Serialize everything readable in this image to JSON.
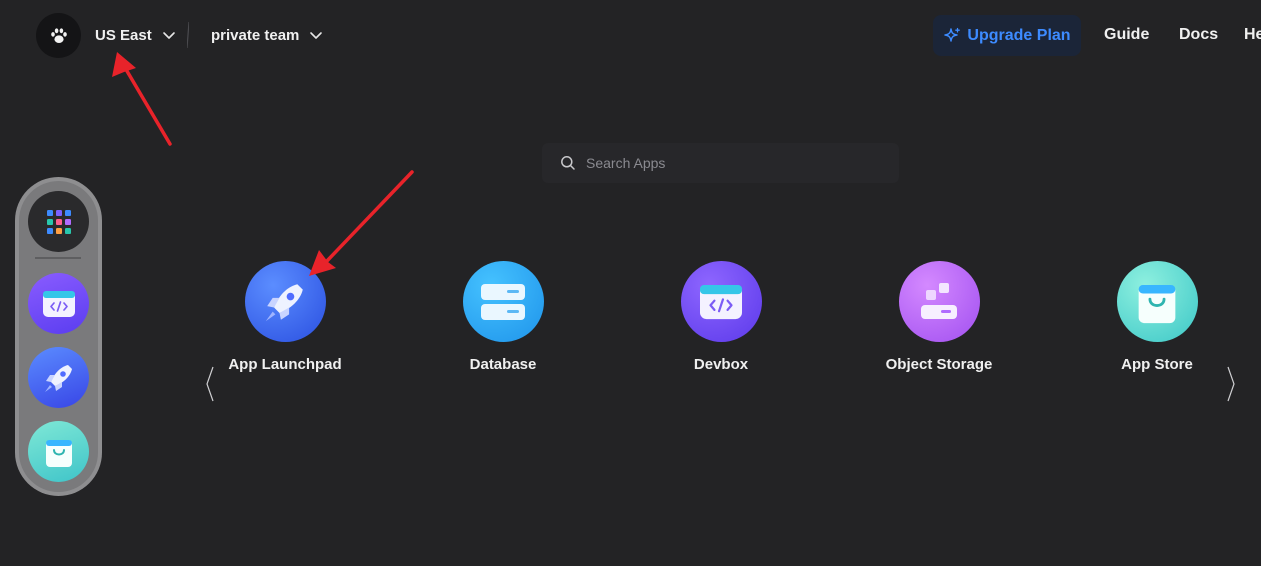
{
  "header": {
    "avatar_icon": "paw-icon",
    "region": "US East",
    "team": "private team",
    "upgrade_label": "Upgrade Plan",
    "links": [
      "Guide",
      "Docs",
      "He"
    ]
  },
  "search": {
    "placeholder": "Search Apps"
  },
  "dock": {
    "items": [
      "apps-grid-icon",
      "devbox-icon",
      "app-launchpad-icon",
      "app-store-icon"
    ]
  },
  "apps": [
    {
      "label": "App Launchpad",
      "icon": "rocket-icon"
    },
    {
      "label": "Database",
      "icon": "database-icon"
    },
    {
      "label": "Devbox",
      "icon": "devbox-icon"
    },
    {
      "label": "Object Storage",
      "icon": "object-storage-icon"
    },
    {
      "label": "App Store",
      "icon": "shopping-bag-icon"
    }
  ],
  "colors": {
    "background": "#232325",
    "accent": "#3d8bff",
    "annotation_arrow": "#e8232a"
  }
}
